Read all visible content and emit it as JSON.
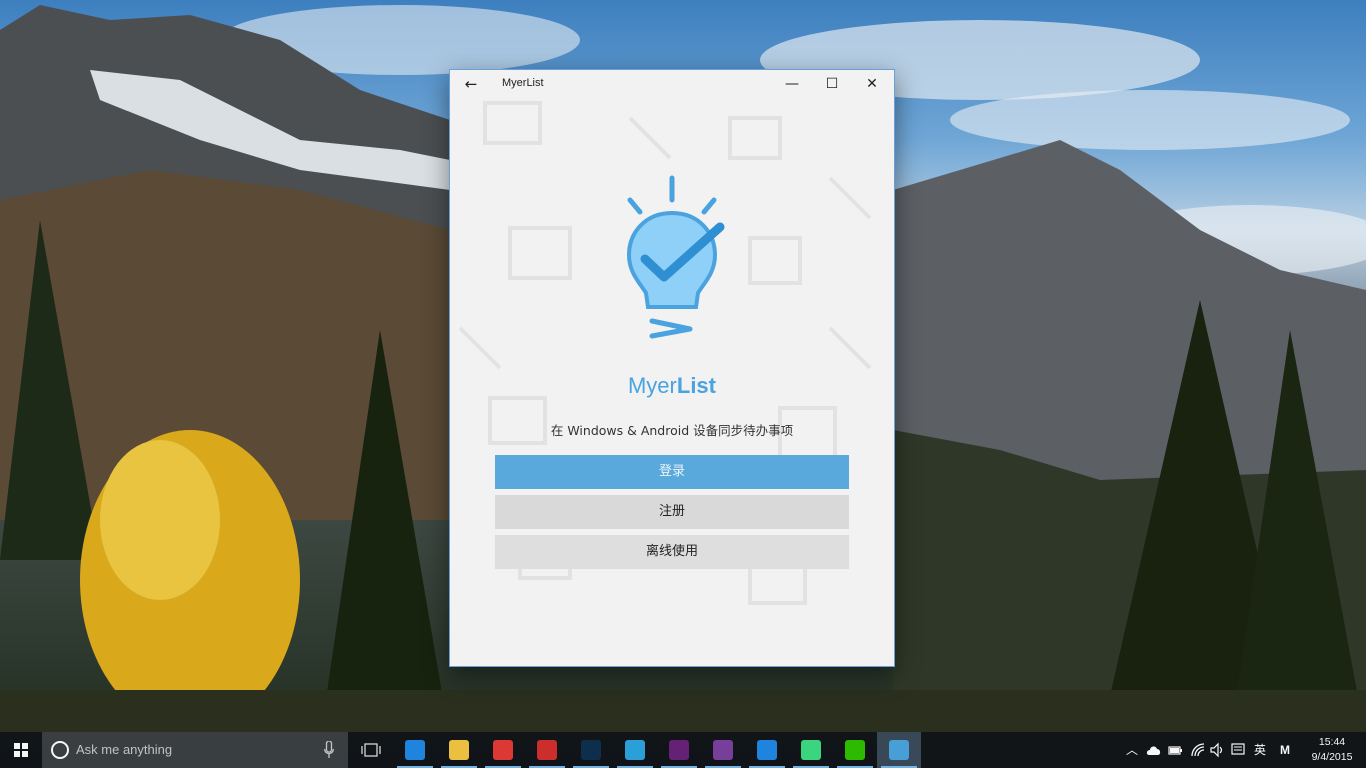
{
  "window": {
    "title": "MyerList",
    "back_glyph": "←",
    "min_glyph": "—",
    "max_glyph": "☐",
    "close_glyph": "✕"
  },
  "app": {
    "brand_light": "Myer",
    "brand_bold": "List",
    "tagline": "在 Windows & Android 设备同步待办事项",
    "login_label": "登录",
    "register_label": "注册",
    "offline_label": "离线使用",
    "accent": "#4aa3df"
  },
  "taskbar": {
    "search_placeholder": "Ask me anything",
    "apps": [
      {
        "name": "edge-icon",
        "color": "#1e88e5"
      },
      {
        "name": "file-explorer-icon",
        "color": "#f4c542"
      },
      {
        "name": "chrome-icon",
        "color": "#e53935"
      },
      {
        "name": "netease-music-icon",
        "color": "#d32f2f"
      },
      {
        "name": "photoshop-icon",
        "color": "#0d2f4f"
      },
      {
        "name": "telegram-icon",
        "color": "#2ca5e0"
      },
      {
        "name": "visual-studio-icon",
        "color": "#68217a"
      },
      {
        "name": "visual-studio-blend-icon",
        "color": "#7b3fa0"
      },
      {
        "name": "visual-studio-code-icon",
        "color": "#1e88e5"
      },
      {
        "name": "android-studio-icon",
        "color": "#3ddc84"
      },
      {
        "name": "wechat-icon",
        "color": "#2dc100"
      },
      {
        "name": "myerlist-taskbar-icon",
        "color": "#4aa3df"
      }
    ],
    "ime_label": "英",
    "clock_time": "15:44",
    "clock_date": "9/4/2015"
  }
}
